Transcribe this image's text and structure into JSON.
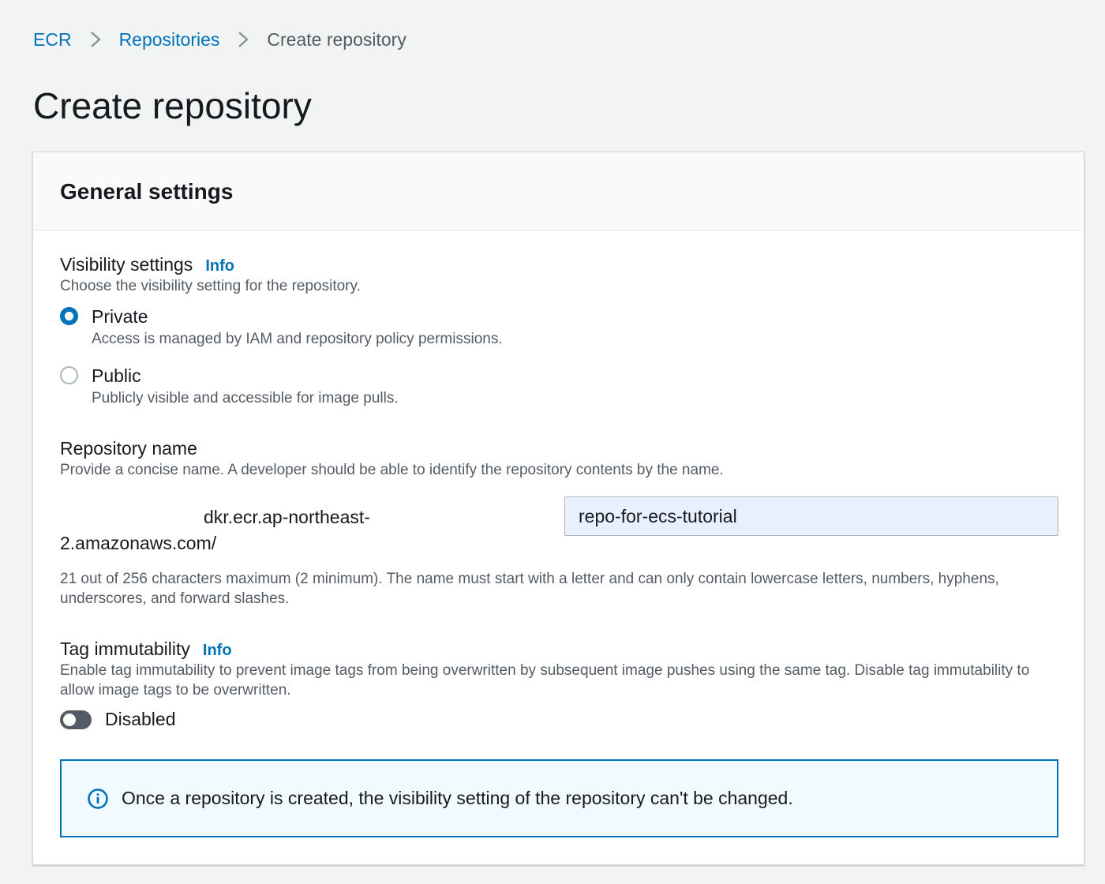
{
  "breadcrumb": {
    "items": [
      {
        "label": "ECR"
      },
      {
        "label": "Repositories"
      },
      {
        "label": "Create repository"
      }
    ]
  },
  "page": {
    "title": "Create repository"
  },
  "general_settings": {
    "heading": "General settings",
    "visibility": {
      "label": "Visibility settings",
      "info": "Info",
      "description": "Choose the visibility setting for the repository.",
      "options": [
        {
          "title": "Private",
          "description": "Access is managed by IAM and repository policy permissions.",
          "selected": true
        },
        {
          "title": "Public",
          "description": "Publicly visible and accessible for image pulls.",
          "selected": false
        }
      ]
    },
    "repository_name": {
      "label": "Repository name",
      "description": "Provide a concise name. A developer should be able to identify the repository contents by the name.",
      "prefix": "dkr.ecr.ap-northeast-2.amazonaws.com/",
      "value": "repo-for-ecs-tutorial",
      "constraint": "21 out of 256 characters maximum (2 minimum). The name must start with a letter and can only contain lowercase letters, numbers, hyphens, underscores, and forward slashes."
    },
    "tag_immutability": {
      "label": "Tag immutability",
      "info": "Info",
      "description": "Enable tag immutability to prevent image tags from being overwritten by subsequent image pushes using the same tag. Disable tag immutability to allow image tags to be overwritten.",
      "toggle_label": "Disabled",
      "enabled": false
    },
    "alert": {
      "icon": "info-circle-icon",
      "text": "Once a repository is created, the visibility setting of the repository can't be changed."
    }
  },
  "colors": {
    "link": "#0073bb",
    "page_background": "#f2f3f3",
    "input_autofill": "#e8f0fe",
    "alert_border": "#0073bb",
    "alert_background": "#f1faff"
  }
}
